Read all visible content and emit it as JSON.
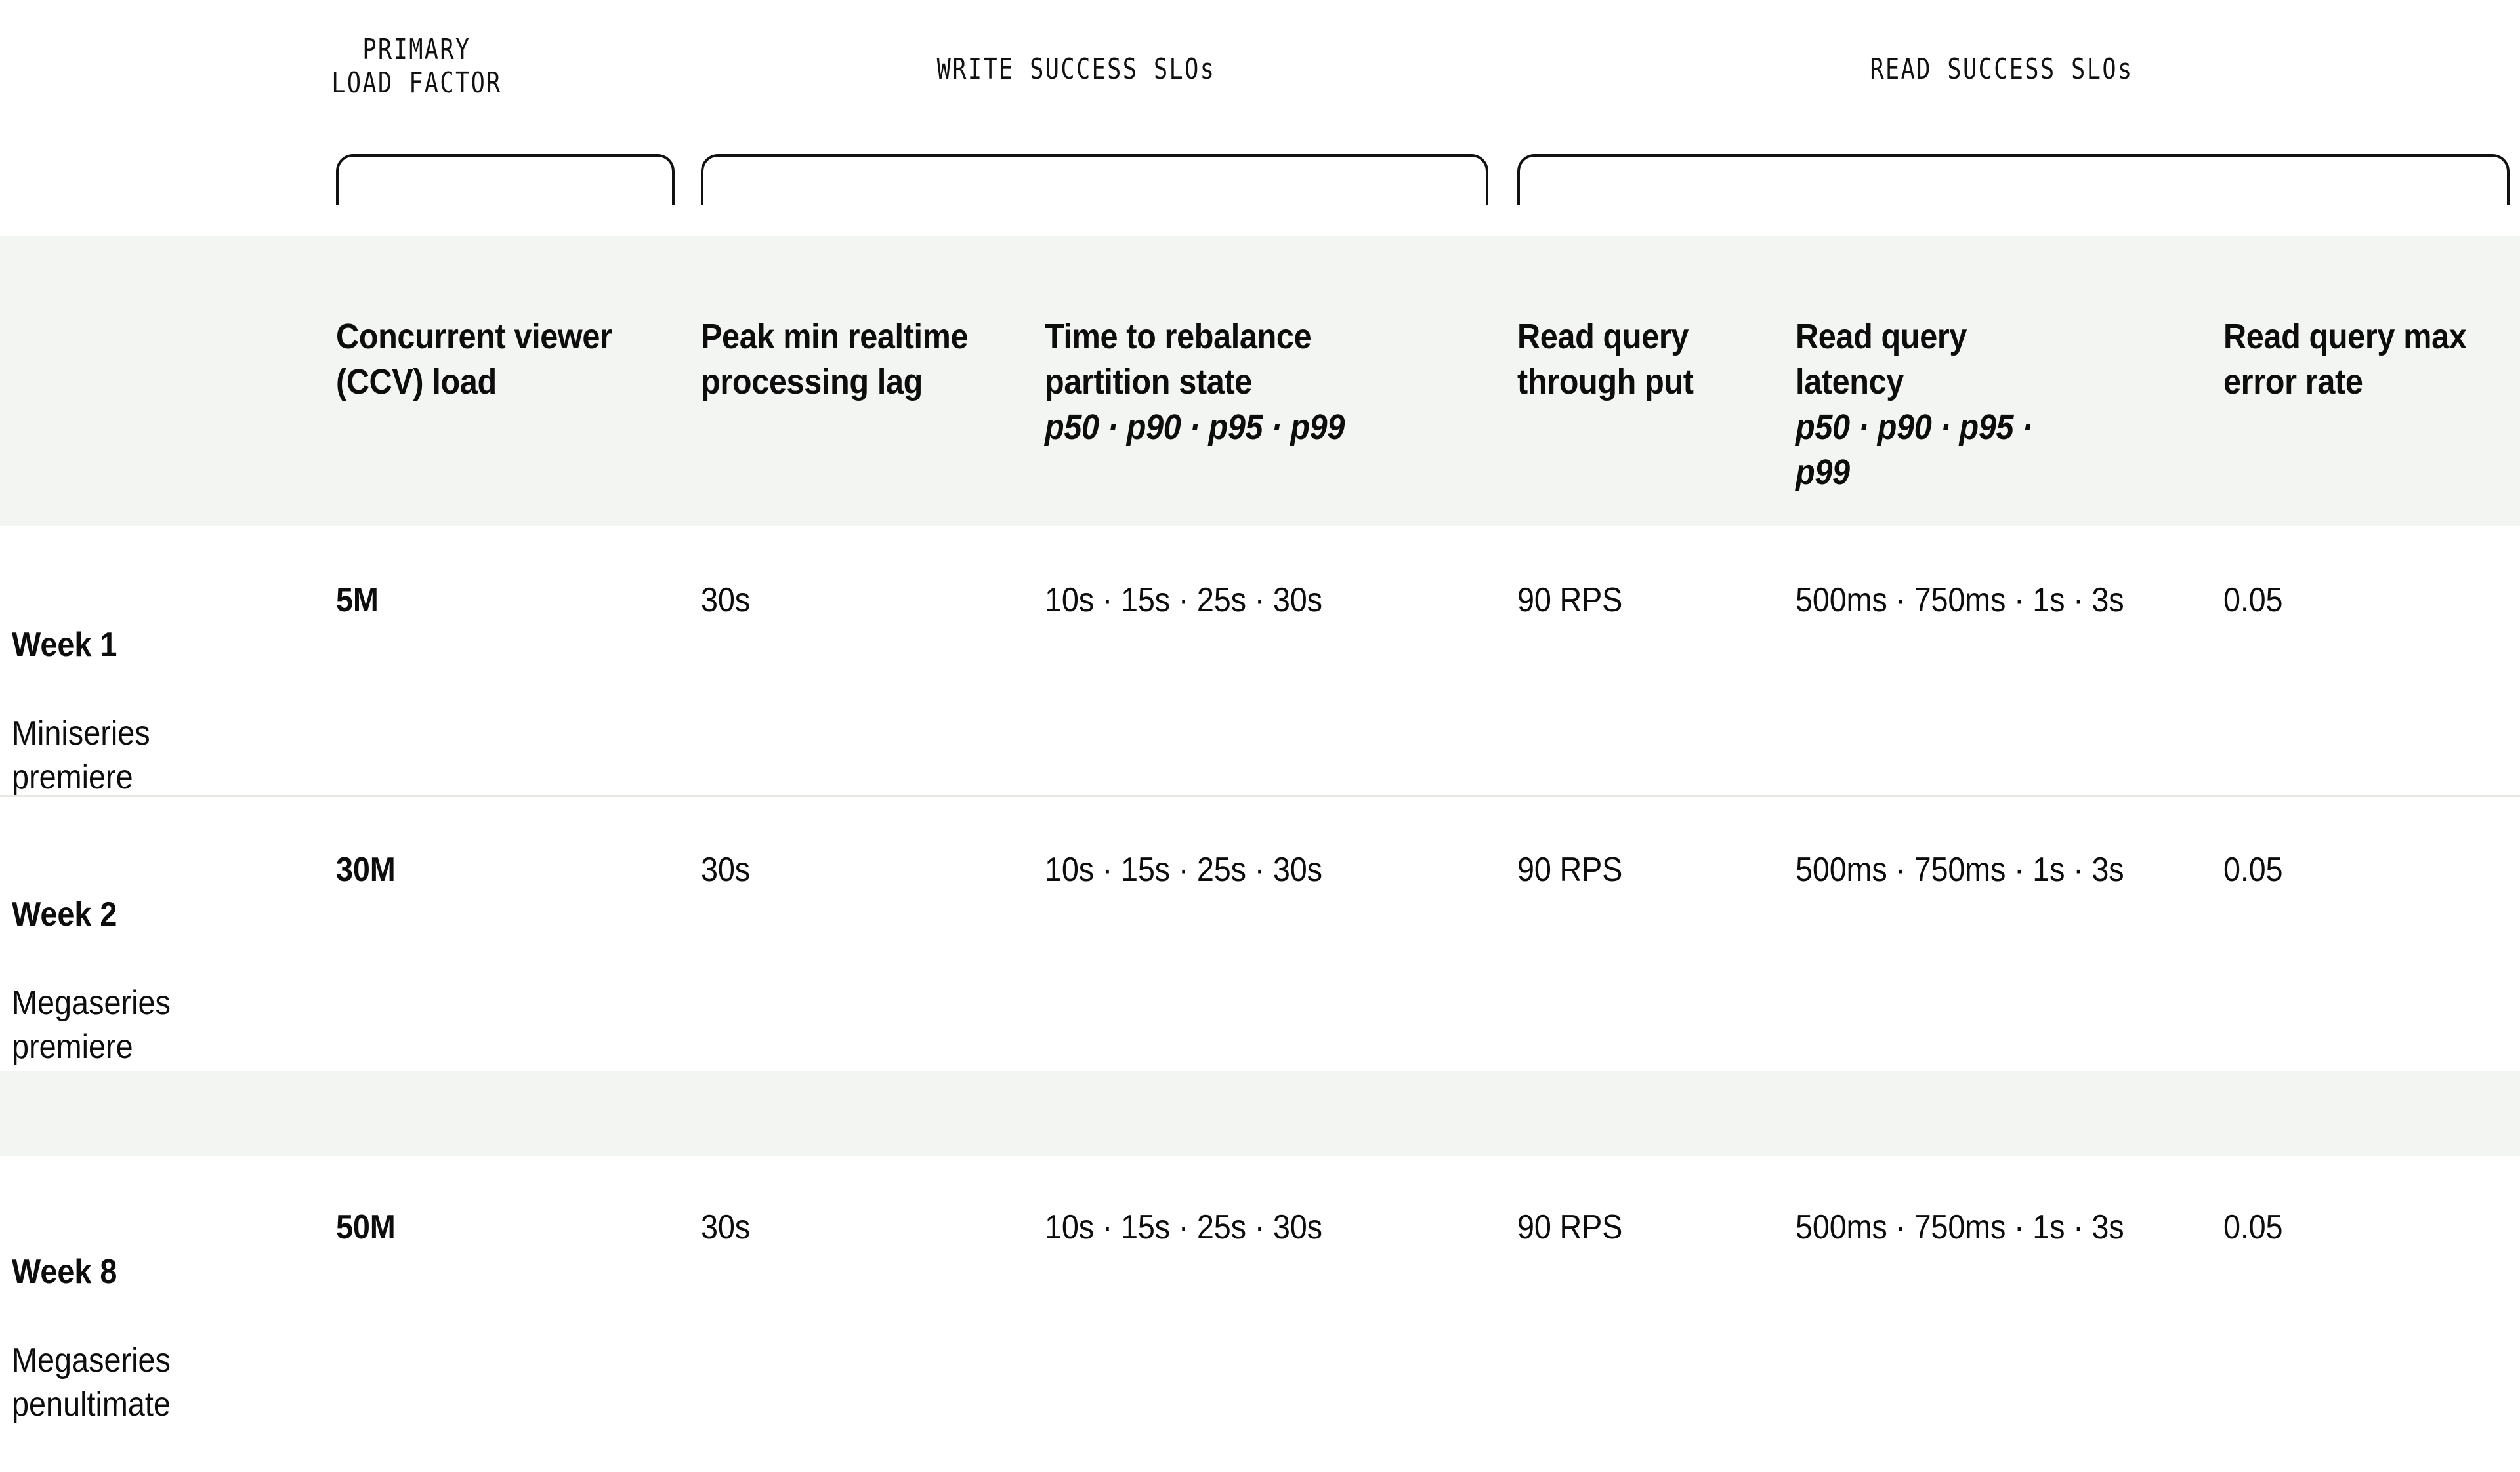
{
  "colors": {
    "page_background": "#ffffff",
    "header_band": "#f3f5f2",
    "skipped_row_band": "#f3f5f2",
    "row_divider": "#e6e8e4",
    "text": "#0d0d0d",
    "bracket_stroke": "#111111"
  },
  "column_groups": [
    {
      "label": "PRIMARY\nLOAD FACTOR",
      "spans_columns": 1
    },
    {
      "label": "WRITE SUCCESS SLOs",
      "spans_columns": 2
    },
    {
      "label": "READ SUCCESS SLOs",
      "spans_columns": 3
    }
  ],
  "table": {
    "columns": [
      {
        "key": "scenario",
        "header": "",
        "percentiles": ""
      },
      {
        "key": "ccv_load",
        "header": "Concurrent viewer (CCV) load",
        "percentiles": ""
      },
      {
        "key": "peak_lag",
        "header": "Peak min realtime processing lag",
        "percentiles": ""
      },
      {
        "key": "rebalance_time",
        "header": "Time to rebalance partition state",
        "percentiles": "p50 · p90 · p95 · p99"
      },
      {
        "key": "read_throughput",
        "header": "Read query through put",
        "percentiles": ""
      },
      {
        "key": "read_latency",
        "header": "Read query latency",
        "percentiles": "p50 · p90 · p95 · p99"
      },
      {
        "key": "read_error_rate",
        "header": "Read query max error rate",
        "percentiles": ""
      }
    ],
    "rows": [
      {
        "type": "data",
        "scenario_week": "Week 1",
        "scenario_detail": "Miniseries premiere",
        "ccv_load": "5M",
        "peak_lag": "30s",
        "rebalance_time": "10s · 15s · 25s · 30s",
        "read_throughput": "90 RPS",
        "read_latency": "500ms · 750ms · 1s · 3s",
        "read_error_rate": "0.05"
      },
      {
        "type": "data",
        "scenario_week": "Week 2",
        "scenario_detail": "Megaseries premiere",
        "ccv_load": "30M",
        "peak_lag": "30s",
        "rebalance_time": "10s · 15s · 25s · 30s",
        "read_throughput": "90 RPS",
        "read_latency": "500ms · 750ms · 1s · 3s",
        "read_error_rate": "0.05"
      },
      {
        "type": "skipped",
        "scenario_week": "",
        "scenario_detail": "",
        "ccv_load": "",
        "peak_lag": "",
        "rebalance_time": "",
        "read_throughput": "",
        "read_latency": "",
        "read_error_rate": ""
      },
      {
        "type": "data",
        "scenario_week": "Week 8",
        "scenario_detail": "Megaseries penultimate",
        "ccv_load": "50M",
        "peak_lag": "30s",
        "rebalance_time": "10s · 15s · 25s · 30s",
        "read_throughput": "90 RPS",
        "read_latency": "500ms · 750ms · 1s · 3s",
        "read_error_rate": "0.05"
      }
    ]
  }
}
